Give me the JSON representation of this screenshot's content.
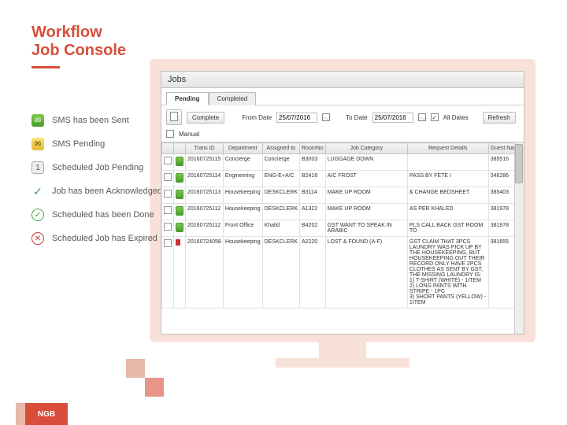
{
  "title_line1": "Workflow",
  "title_line2": "Job Console",
  "legend": [
    {
      "icon": "sms-sent-icon",
      "label": "SMS  has been Sent"
    },
    {
      "icon": "sms-pending-icon",
      "label": "SMS Pending"
    },
    {
      "icon": "sched-pend-icon",
      "label": "Scheduled Job Pending"
    },
    {
      "icon": "ack-icon",
      "label": "Job has been Acknowledged"
    },
    {
      "icon": "sched-done-icon",
      "label": "Scheduled  has been Done"
    },
    {
      "icon": "sched-exp-icon",
      "label": "Scheduled Job has Expired"
    }
  ],
  "app": {
    "window_title": "Jobs",
    "tabs": [
      {
        "label": "Pending",
        "active": true
      },
      {
        "label": "Completed",
        "active": false
      }
    ],
    "toolbar": {
      "new_icon": "new",
      "complete_label": "Complete",
      "from_label": "From Date",
      "from_value": "25/07/2016",
      "to_label": "To Date",
      "to_value": "25/07/2016",
      "alldates_label": "All Dates",
      "alldates_checked": true,
      "refresh_label": "Refresh",
      "manual_label": "Manual",
      "manual_checked": false
    },
    "columns": [
      "",
      "",
      "Trans ID",
      "Department",
      "Assigned to",
      "RoomNo",
      "Job Category",
      "Request Details",
      "Guest Name"
    ],
    "rows": [
      {
        "flag": "",
        "trans": "20160725115",
        "dept": "Concierge",
        "assigned": "Concierge",
        "room": "B3003",
        "cat": "LUGGAGE DOWN",
        "details": "",
        "guest": "385516"
      },
      {
        "flag": "",
        "trans": "20160725114",
        "dept": "Engineering",
        "assigned": "ENG-E+A/C",
        "room": "B2416",
        "cat": "A/C FROST",
        "details": "PASS BY FETE I",
        "guest": "346286"
      },
      {
        "flag": "",
        "trans": "20160725113",
        "dept": "Housekeeping",
        "assigned": "DESKCLERK",
        "room": "B3114",
        "cat": "MAKE UP ROOM",
        "details": "& CHANGE BEDSHEET.",
        "guest": "385403"
      },
      {
        "flag": "",
        "trans": "20160725112",
        "dept": "Housekeeping",
        "assigned": "DESKCLERK",
        "room": "A1322",
        "cat": "MAKE UP ROOM",
        "details": "AS PER KHALED",
        "guest": "381978"
      },
      {
        "flag": "",
        "trans": "20160725112",
        "dept": "Front Office",
        "assigned": "Khalid",
        "room": "B4202",
        "cat": "GST WANT TO SPEAK IN ARABIC",
        "details": "PLS CALL BACK GST ROOM TO",
        "guest": "381978"
      },
      {
        "flag": "red",
        "trans": "20160724058",
        "dept": "Housekeeping",
        "assigned": "DESKCLERK",
        "room": "A2220",
        "cat": "LOST & FOUND (A-F)",
        "details": "GST CLAIM THAT 3PCS LAUNDRY WAS PICK UP BY THE HOUSEKEEPING, BUT HOUSEKEEPING OUT THEIR RECORD ONLY HAVE 2PCS CLOTHES AS SENT BY GST, THE MISSING LAUNDRY IS:\n1) T-SHIRT (WHITE) - 1ITEM\n2) LONG PANTS WITH STRIPE - 1PC\n3) SHORT PANTS (YELLOW) - 1ITEM",
        "guest": "381655"
      }
    ]
  }
}
